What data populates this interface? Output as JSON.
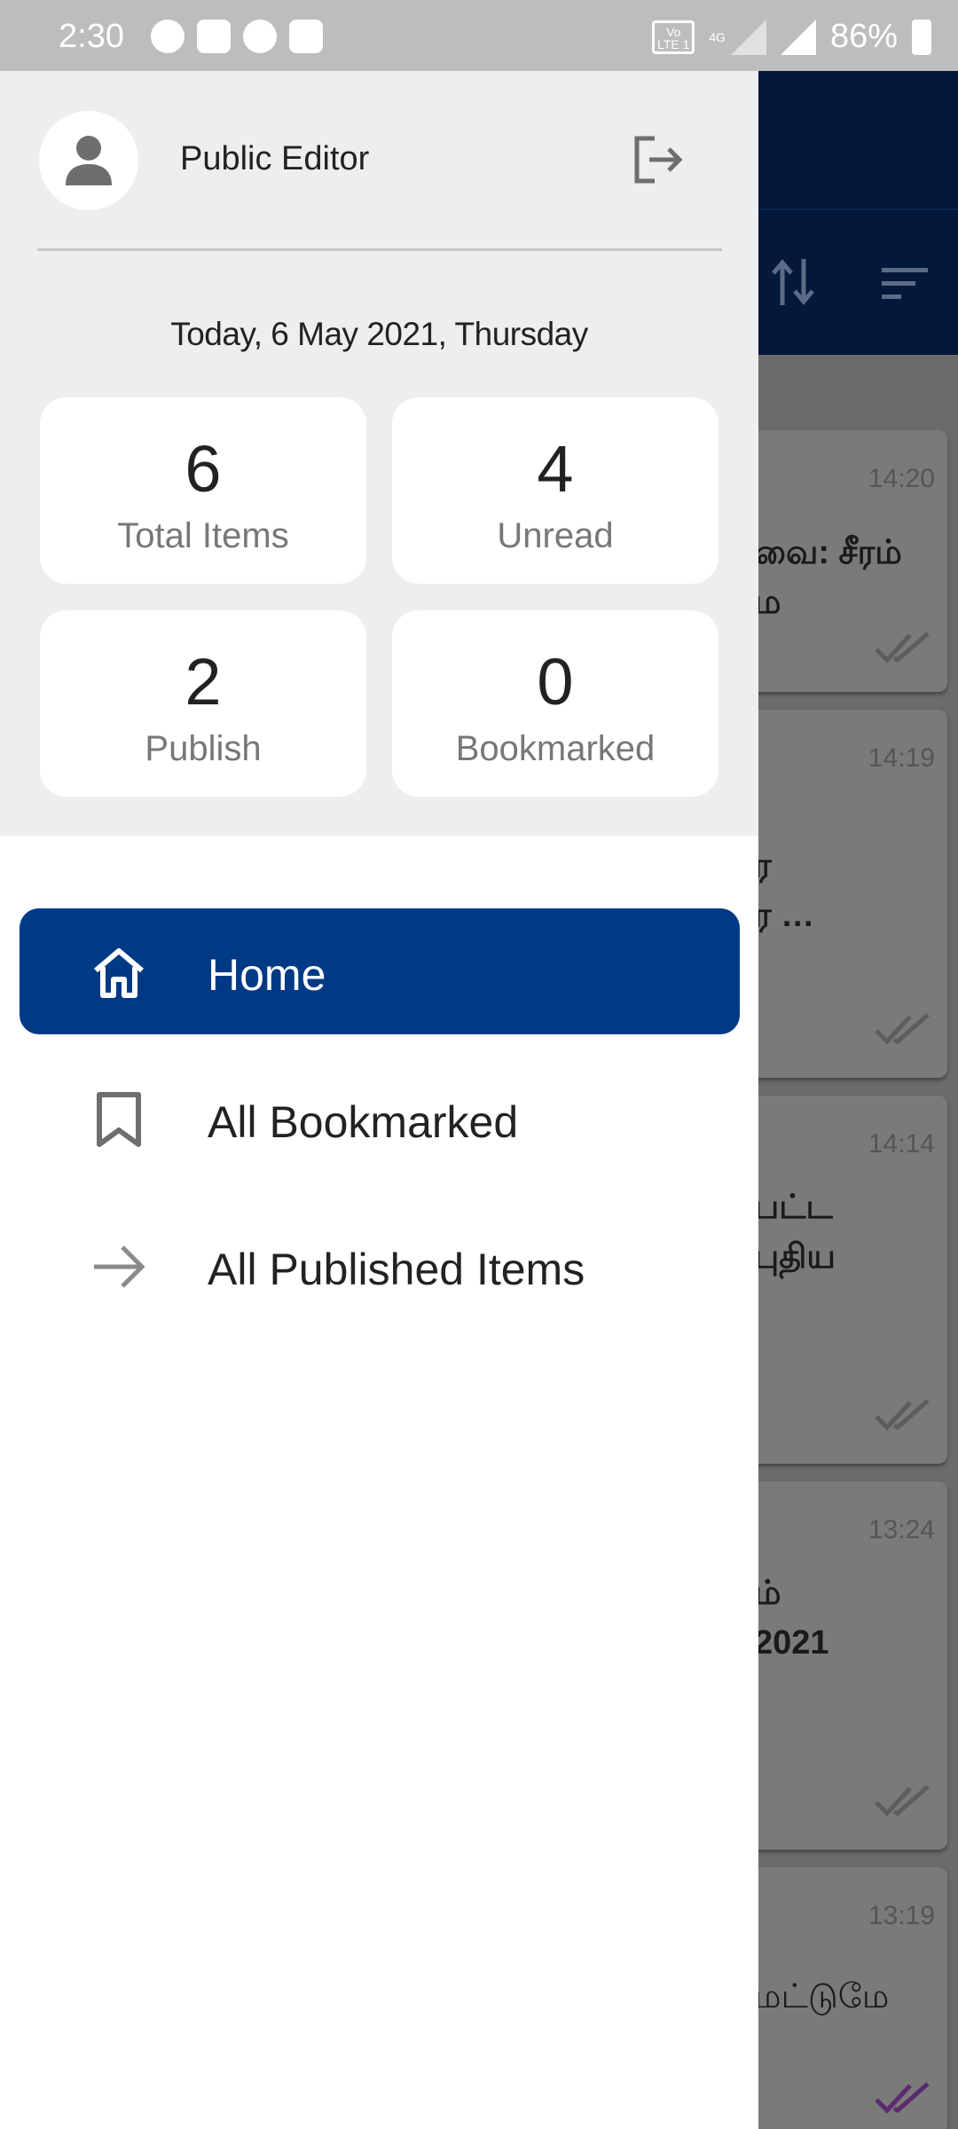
{
  "status_bar": {
    "time": "2:30",
    "volte_label": "Vo LTE 1",
    "network_label": "4G",
    "battery_percent": "86%"
  },
  "drawer": {
    "user_name": "Public Editor",
    "date": "Today, 6 May 2021, Thursday",
    "stats": {
      "total_items": {
        "value": "6",
        "label": "Total Items"
      },
      "unread": {
        "value": "4",
        "label": "Unread"
      },
      "publish": {
        "value": "2",
        "label": "Publish"
      },
      "bookmarked": {
        "value": "0",
        "label": "Bookmarked"
      }
    },
    "nav": [
      {
        "label": "Home",
        "icon": "home-icon",
        "active": true
      },
      {
        "label": "All Bookmarked",
        "icon": "bookmark-icon",
        "active": false
      },
      {
        "label": "All Published Items",
        "icon": "arrow-right-icon",
        "active": false
      }
    ]
  },
  "background_list": {
    "items": [
      {
        "time": "14:20",
        "line1": "வை: சீரம்",
        "line2": "ம"
      },
      {
        "time": "14:19",
        "line1": "ர",
        "line2": "ர …"
      },
      {
        "time": "14:14",
        "line1": "பட்ட",
        "line2": " புதிய"
      },
      {
        "time": "13:24",
        "line1": "ம்",
        "line2": "2021"
      },
      {
        "time": "13:19",
        "line1": " மட்டுமே",
        "line2": ""
      }
    ]
  },
  "colors": {
    "accent": "#003a85",
    "header_dark": "#03183a",
    "drawer_header_bg": "#eeeeee"
  }
}
